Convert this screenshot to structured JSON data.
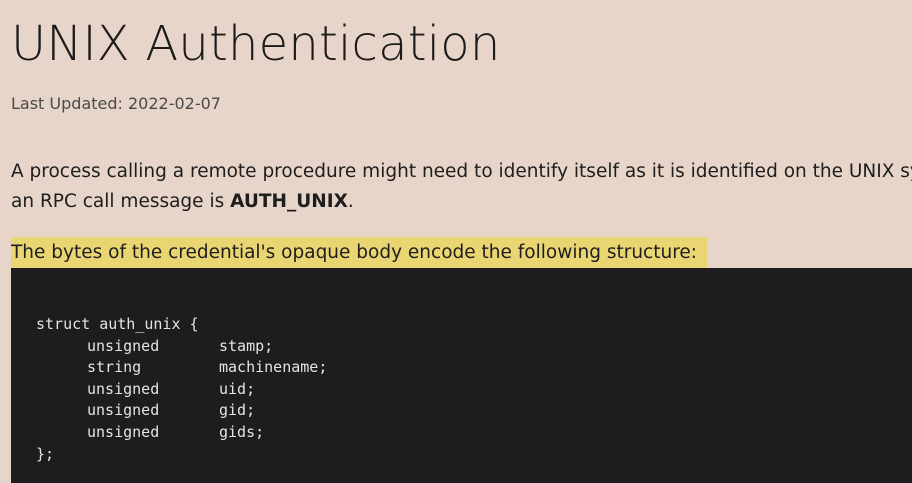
{
  "title": "UNIX Authentication",
  "last_updated": "Last Updated: 2022-02-07",
  "intro": {
    "line1": "A process calling a remote procedure might need to identify itself as it is identified on the UNIX syste",
    "line2_prefix": "an RPC call message is ",
    "line2_bold": "AUTH_UNIX",
    "line2_suffix": "."
  },
  "highlighted_sentence": "The bytes of the credential's opaque body encode the following structure:",
  "code": {
    "open": "struct auth_unix {",
    "fields": [
      {
        "type": "unsigned",
        "name": "stamp;"
      },
      {
        "type": "string",
        "name": "machinename;"
      },
      {
        "type": "unsigned",
        "name": "uid;"
      },
      {
        "type": "unsigned",
        "name": "gid;"
      },
      {
        "type": "unsigned",
        "name": "gids;"
      }
    ],
    "close": "};"
  }
}
